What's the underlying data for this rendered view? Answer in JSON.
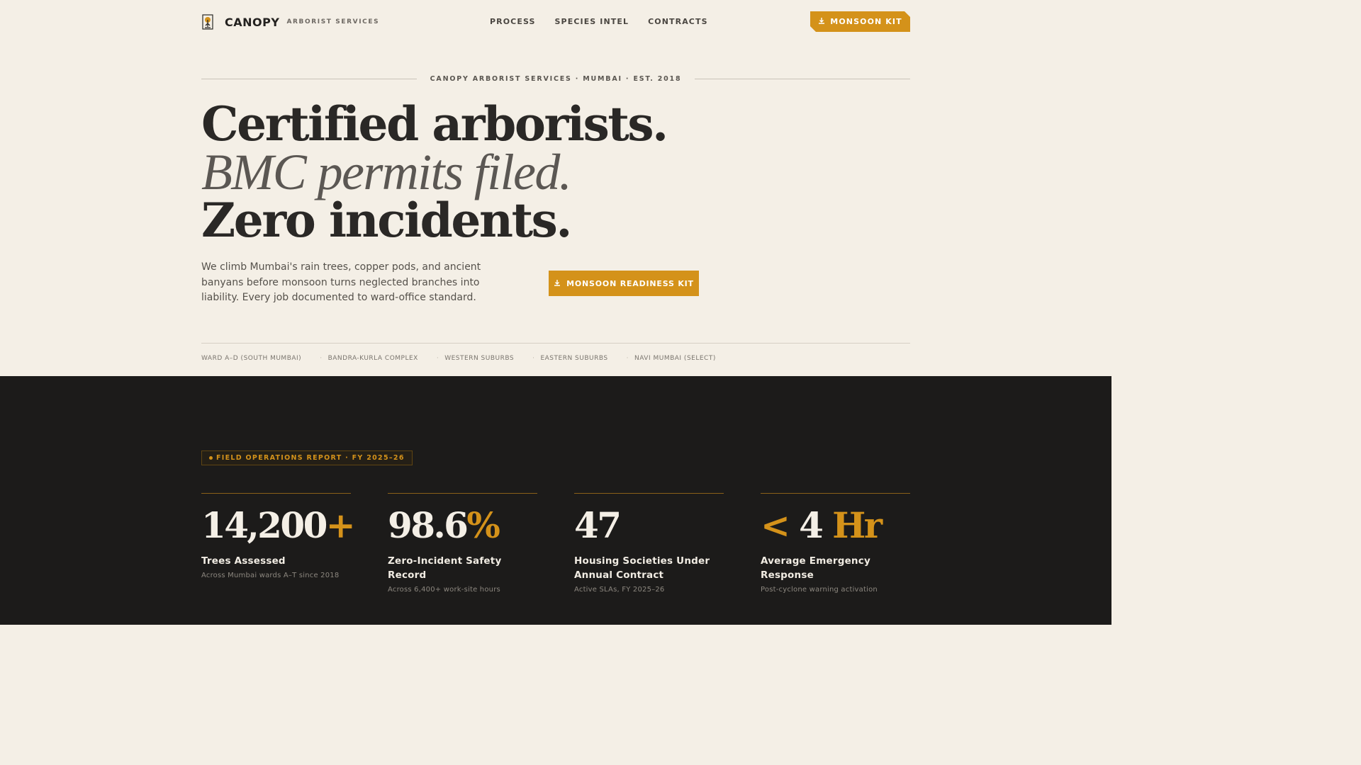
{
  "nav": {
    "brand_name": "CANOPY",
    "brand_sub": "ARBORIST SERVICES",
    "links": [
      "PROCESS",
      "SPECIES INTEL",
      "CONTRACTS"
    ],
    "cta_label": "MONSOON KIT",
    "cta_icon": "download-icon",
    "logo_icon": "tree-icon"
  },
  "hero": {
    "eyebrow": "CANOPY ARBORIST SERVICES · MUMBAI · EST. 2018",
    "headline_1": "Certified arborists.",
    "headline_2": "BMC permits filed.",
    "headline_3": "Zero incidents.",
    "lede": "We climb Mumbai's rain trees, copper pods, and ancient banyans before monsoon turns neglected branches into liability. Every job documented to ward-office standard.",
    "cta_label": "MONSOON READINESS KIT"
  },
  "wards": [
    "WARD A–D (SOUTH MUMBAI)",
    "BANDRA-KURLA COMPLEX",
    "WESTERN SUBURBS",
    "EASTERN SUBURBS",
    "NAVI MUMBAI (SELECT)"
  ],
  "report": {
    "badge": "FIELD OPERATIONS REPORT · FY 2025–26",
    "stats": [
      {
        "prefix": "",
        "value": "14,200",
        "suffix": "+",
        "label": "Trees Assessed",
        "sub": "Across Mumbai wards A–T since 2018"
      },
      {
        "prefix": "",
        "value": "98.6",
        "suffix": "%",
        "label": "Zero-Incident Safety Record",
        "sub": "Across 6,400+ work-site hours"
      },
      {
        "prefix": "",
        "value": "47",
        "suffix": "",
        "label": "Housing Societies Under Annual Contract",
        "sub": "Active SLAs, FY 2025–26"
      },
      {
        "prefix": "< ",
        "value": "4",
        "suffix": " Hr",
        "label": "Average Emergency Response",
        "sub": "Post-cyclone warning activation"
      }
    ]
  },
  "colors": {
    "accent": "#d4921a",
    "background": "#f4efe6",
    "dark": "#1c1b1a"
  }
}
